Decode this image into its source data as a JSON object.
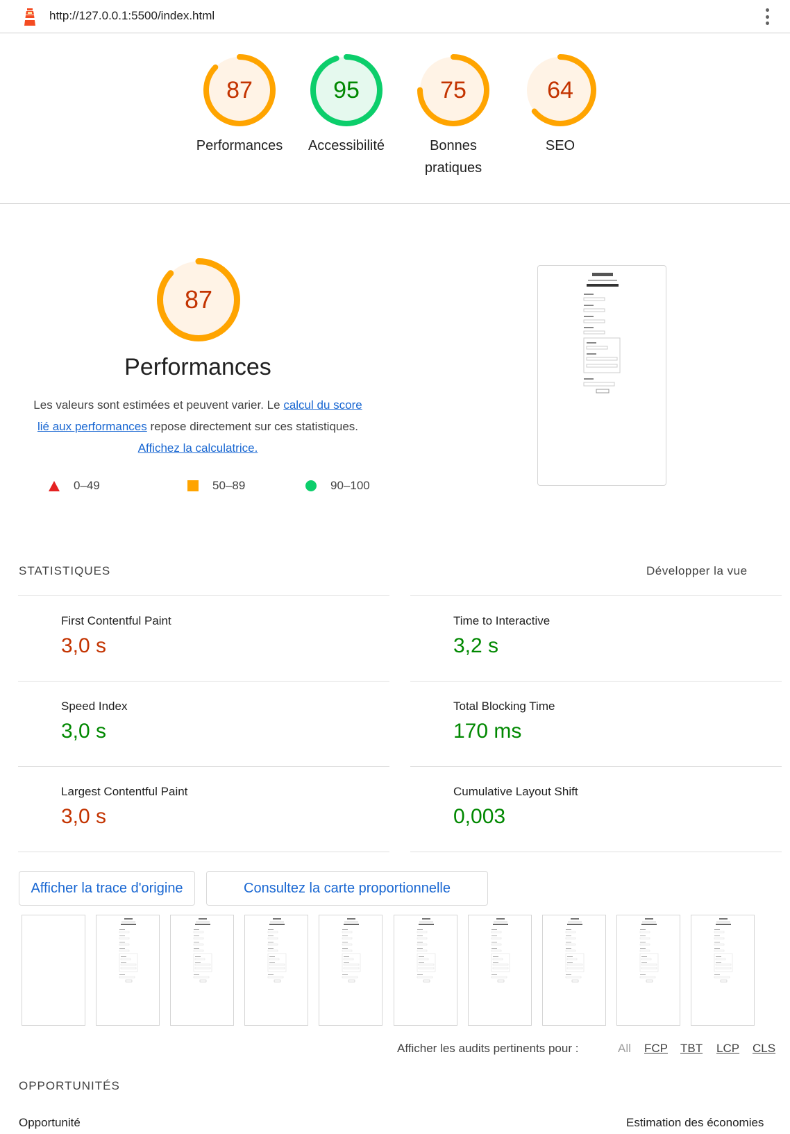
{
  "browser": {
    "url": "http://127.0.0.1:5500/index.html"
  },
  "scores": [
    {
      "label": "Performances",
      "value": "87",
      "fraction": 0.87,
      "rating": "average"
    },
    {
      "label": "Accessibilité",
      "value": "95",
      "fraction": 0.95,
      "rating": "pass"
    },
    {
      "label": "Bonnes pratiques",
      "value": "75",
      "fraction": 0.75,
      "rating": "average"
    },
    {
      "label": "SEO",
      "value": "64",
      "fraction": 0.64,
      "rating": "average"
    }
  ],
  "performance": {
    "score": "87",
    "fraction": 0.87,
    "title": "Performances",
    "desc_text1": "Les valeurs sont estimées et peuvent varier. Le ",
    "desc_link1": "calcul du score lié aux performances",
    "desc_text2": " repose directement sur ces statistiques. ",
    "desc_link2": "Affichez la calculatrice.",
    "legend": [
      "0–49",
      "50–89",
      "90–100"
    ]
  },
  "statistics": {
    "title": "STATISTIQUES",
    "expand_label": "Développer la vue",
    "metrics_left": [
      {
        "label": "First Contentful Paint",
        "value": "3,0 s",
        "rating": "fail"
      },
      {
        "label": "Speed Index",
        "value": "3,0 s",
        "rating": "pass"
      },
      {
        "label": "Largest Contentful Paint",
        "value": "3,0 s",
        "rating": "fail"
      }
    ],
    "metrics_right": [
      {
        "label": "Time to Interactive",
        "value": "3,2 s",
        "rating": "pass"
      },
      {
        "label": "Total Blocking Time",
        "value": "170 ms",
        "rating": "pass"
      },
      {
        "label": "Cumulative Layout Shift",
        "value": "0,003",
        "rating": "pass"
      }
    ]
  },
  "buttons": {
    "trace": "Afficher la trace d'origine",
    "treemap": "Consultez la carte proportionnelle"
  },
  "filter": {
    "label": "Afficher les audits pertinents pour :",
    "options": [
      "All",
      "FCP",
      "TBT",
      "LCP",
      "CLS"
    ]
  },
  "opportunities": {
    "title": "OPPORTUNITÉS",
    "col_left": "Opportunité",
    "col_right": "Estimation des économies"
  },
  "colors": {
    "orange": "#ffa400",
    "orange_bg": "#fff3e6",
    "green": "#0cce6b",
    "green_bg": "#e5f9ee",
    "link": "#1967d2"
  }
}
